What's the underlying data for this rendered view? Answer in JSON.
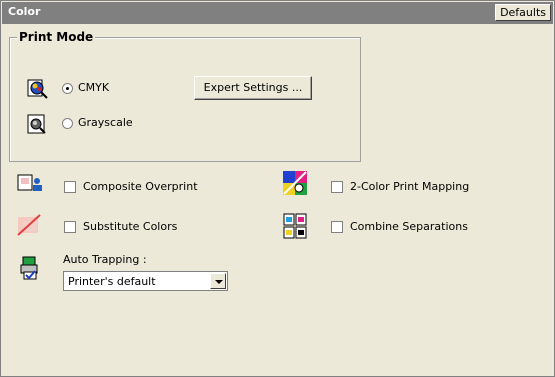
{
  "panel": {
    "title": "Color",
    "defaults_label": "Defaults"
  },
  "print_mode": {
    "legend": "Print Mode",
    "options": [
      {
        "label": "CMYK",
        "selected": true,
        "icon": "cmyk-mode-icon"
      },
      {
        "label": "Grayscale",
        "selected": false,
        "icon": "grayscale-mode-icon"
      }
    ],
    "expert_settings_label": "Expert Settings ..."
  },
  "options": {
    "composite_overprint": {
      "label": "Composite Overprint",
      "checked": false,
      "icon": "overprint-icon"
    },
    "substitute_colors": {
      "label": "Substitute Colors",
      "checked": false,
      "icon": "substitute-colors-icon"
    },
    "two_color_mapping": {
      "label": "2-Color Print Mapping",
      "checked": false,
      "icon": "color-mapping-icon"
    },
    "combine_separations": {
      "label": "Combine Separations",
      "checked": false,
      "icon": "separations-icon"
    }
  },
  "auto_trapping": {
    "label": "Auto Trapping :",
    "selected": "Printer's default",
    "icon": "trapping-icon"
  }
}
